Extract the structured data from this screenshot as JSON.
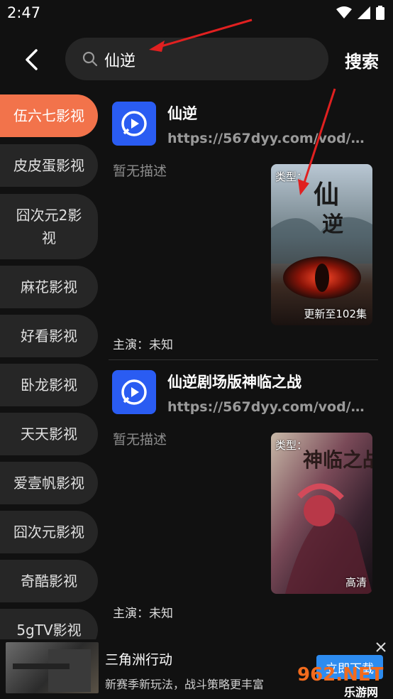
{
  "status_bar": {
    "time": "2:47"
  },
  "header": {
    "search_value": "仙逆",
    "search_button": "搜索"
  },
  "sidebar": {
    "items": [
      {
        "label": "伍六七影视",
        "active": true
      },
      {
        "label": "皮皮蛋影视",
        "active": false
      },
      {
        "label": "囧次元2影视",
        "active": false
      },
      {
        "label": "麻花影视",
        "active": false
      },
      {
        "label": "好看影视",
        "active": false
      },
      {
        "label": "卧龙影视",
        "active": false
      },
      {
        "label": "天天影视",
        "active": false
      },
      {
        "label": "爱壹帆影视",
        "active": false
      },
      {
        "label": "囧次元影视",
        "active": false
      },
      {
        "label": "奇酷影视",
        "active": false
      },
      {
        "label": "5gTV影视",
        "active": false
      }
    ]
  },
  "results": [
    {
      "title": "仙逆",
      "url": "https://567dyy.com/vod/33...",
      "description": "暂无描述",
      "actors": "主演：未知",
      "poster_type": "类型：",
      "poster_badge": "更新至102集"
    },
    {
      "title": "仙逆剧场版神临之战",
      "url": "https://567dyy.com/vod/47...",
      "description": "暂无描述",
      "actors": "主演：未知",
      "poster_type": "类型：",
      "poster_badge": "高清"
    }
  ],
  "ad": {
    "title": "三角洲行动",
    "subtitle": "新赛季新玩法，战斗策略更丰富",
    "button": "立即下载"
  },
  "watermark": {
    "brand": "962.NET",
    "sub": "乐游网"
  },
  "colors": {
    "accent": "#f2734b",
    "background": "#111111",
    "app_icon": "#2a5cf2",
    "annotation": "#e02020"
  }
}
